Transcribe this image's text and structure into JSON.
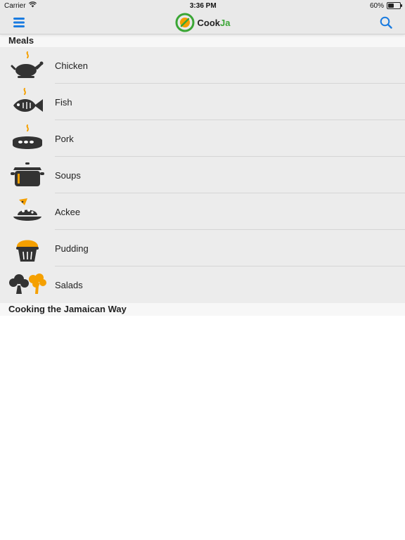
{
  "status": {
    "carrier": "Carrier",
    "time": "3:36 PM",
    "battery": "60%",
    "battery_level": 0.6
  },
  "nav": {
    "app_name_left": "Cook",
    "app_name_right": "Ja",
    "brand_color": "#3aa635",
    "accent_color": "#1a7be0"
  },
  "sections": [
    {
      "title": "Meals"
    },
    {
      "title": "Cooking the Jamaican Way"
    }
  ],
  "meals": [
    {
      "label": "Chicken",
      "icon": "chicken-icon"
    },
    {
      "label": "Fish",
      "icon": "fish-icon"
    },
    {
      "label": "Pork",
      "icon": "pork-icon"
    },
    {
      "label": "Soups",
      "icon": "soup-pot-icon"
    },
    {
      "label": "Ackee",
      "icon": "ackee-plate-icon"
    },
    {
      "label": "Pudding",
      "icon": "pudding-icon"
    },
    {
      "label": "Salads",
      "icon": "broccoli-icon"
    }
  ]
}
